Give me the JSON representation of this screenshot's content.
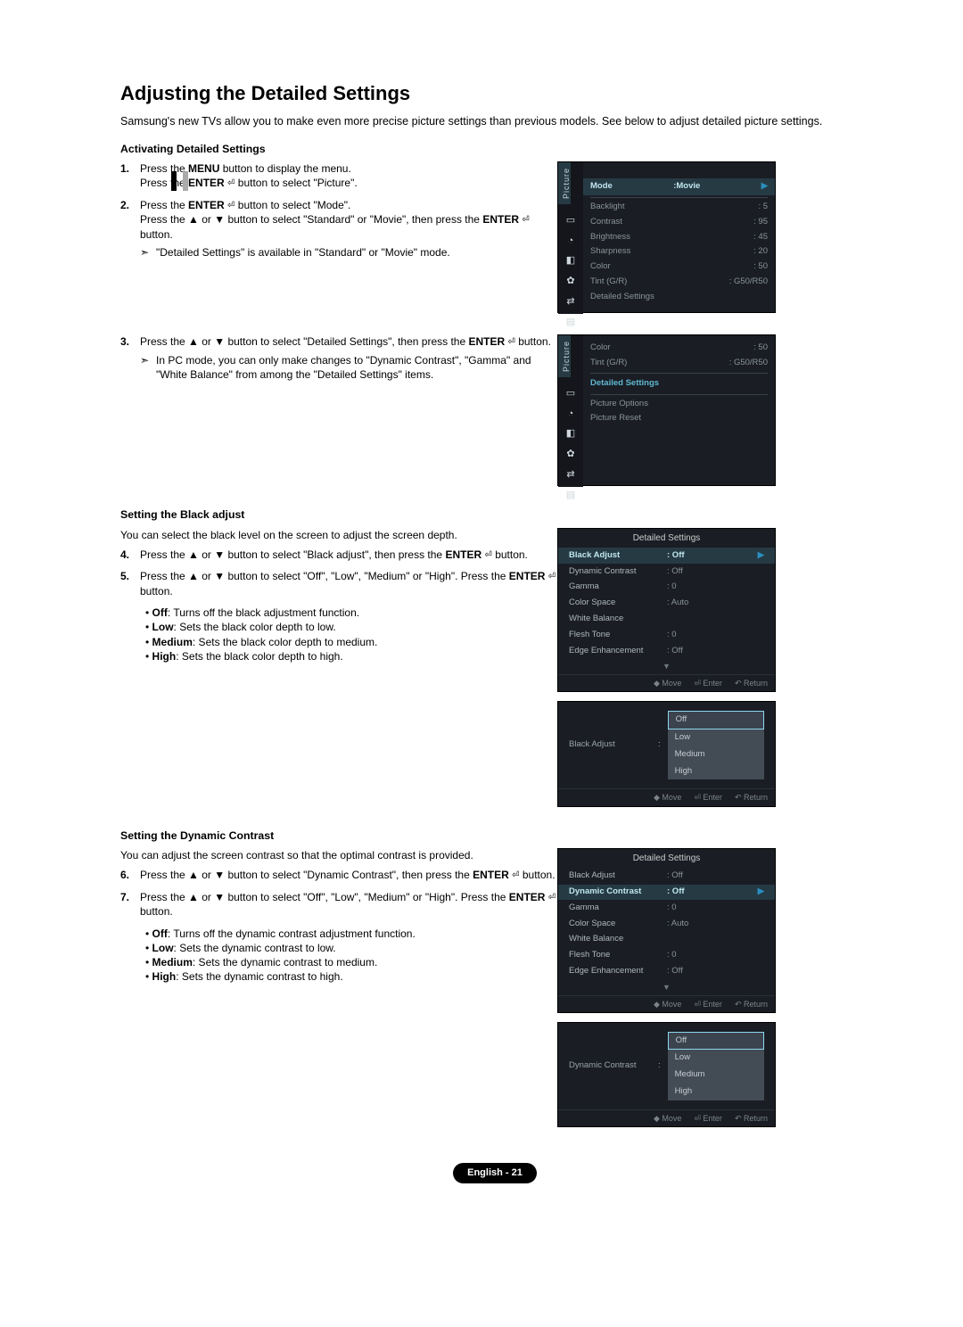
{
  "title": "Adjusting the Detailed Settings",
  "intro": "Samsung's new TVs allow you to make even more precise picture settings than previous models. See below to adjust detailed picture settings.",
  "sec1": {
    "heading": "Activating Detailed Settings",
    "items": [
      {
        "n": "1.",
        "lines": [
          "Press the <b>MENU</b> button to display the menu.",
          "Press the <b>ENTER</b> <span class='enter-icon'>⏎</span> button to select \"Picture\"."
        ]
      },
      {
        "n": "2.",
        "lines": [
          "Press the <b>ENTER</b> <span class='enter-icon'>⏎</span> button to select \"Mode\".",
          "Press the ▲ or ▼ button to select \"Standard\" or \"Movie\", then press the <b>ENTER</b> <span class='enter-icon'>⏎</span> button."
        ],
        "note": "\"Detailed Settings\" is available in \"Standard\" or \"Movie\" mode."
      },
      {
        "n": "3.",
        "lines": [
          "Press the ▲ or ▼ button to select \"Detailed Settings\", then press the <b>ENTER</b> <span class='enter-icon'>⏎</span> button."
        ],
        "note": "In PC mode, you can only make changes to \"Dynamic Contrast\", \"Gamma\" and \"White Balance\" from among the \"Detailed Settings\" items."
      }
    ]
  },
  "sec2": {
    "heading": "Setting the Black adjust",
    "desc": "You can select the black level on the screen to adjust the screen depth.",
    "items": [
      {
        "n": "4.",
        "lines": [
          "Press the ▲ or ▼ button to select \"Black adjust\", then press the <b>ENTER</b> <span class='enter-icon'>⏎</span> button."
        ]
      },
      {
        "n": "5.",
        "lines": [
          "Press the ▲ or ▼ button to select \"Off\", \"Low\", \"Medium\" or \"High\". Press the <b>ENTER</b> <span class='enter-icon'>⏎</span> button."
        ]
      }
    ],
    "bullets": [
      "<b>Off</b>: Turns off the black adjustment function.",
      "<b>Low</b>: Sets the black color depth to low.",
      "<b>Medium</b>: Sets the black color depth to medium.",
      "<b>High</b>: Sets the black color depth to high."
    ]
  },
  "sec3": {
    "heading": "Setting the Dynamic Contrast",
    "desc": "You can adjust the screen contrast so that the optimal contrast is provided.",
    "items": [
      {
        "n": "6.",
        "lines": [
          "Press the ▲ or ▼ button to select \"Dynamic Contrast\", then press the <b>ENTER</b> <span class='enter-icon'>⏎</span> button."
        ]
      },
      {
        "n": "7.",
        "lines": [
          "Press the ▲ or ▼ button to select \"Off\", \"Low\", \"Medium\" or \"High\". Press the <b>ENTER</b> <span class='enter-icon'>⏎</span> button."
        ]
      }
    ],
    "bullets": [
      "<b>Off</b>: Turns off the dynamic contrast adjustment function.",
      "<b>Low</b>: Sets the dynamic contrast to low.",
      "<b>Medium</b>: Sets the dynamic contrast to medium.",
      "<b>High</b>: Sets the dynamic contrast to high."
    ]
  },
  "osd1_tab": "Picture",
  "osd1_rows": [
    {
      "l": "Mode",
      "v": ":Movie",
      "hl": true,
      "arr": true
    },
    {
      "l": "Backlight",
      "v": ": 5"
    },
    {
      "l": "Contrast",
      "v": ": 95"
    },
    {
      "l": "Brightness",
      "v": ": 45"
    },
    {
      "l": "Sharpness",
      "v": ": 20"
    },
    {
      "l": "Color",
      "v": ": 50"
    },
    {
      "l": "Tint (G/R)",
      "v": ": G50/R50"
    },
    {
      "l": "Detailed Settings",
      "v": ""
    }
  ],
  "osd2_rows": [
    {
      "l": "Color",
      "v": ": 50"
    },
    {
      "l": "Tint (G/R)",
      "v": ": G50/R50"
    },
    {
      "l": "Detailed Settings",
      "v": "",
      "hl2": true
    },
    {
      "l": "Picture Options",
      "v": ""
    },
    {
      "l": "Picture Reset",
      "v": ""
    }
  ],
  "osd3_title": "Detailed Settings",
  "osd3_rows": [
    {
      "l": "Black Adjust",
      "v": ": Off",
      "sel": true,
      "arr": true
    },
    {
      "l": "Dynamic Contrast",
      "v": ": Off"
    },
    {
      "l": "Gamma",
      "v": ": 0"
    },
    {
      "l": "Color Space",
      "v": ": Auto"
    },
    {
      "l": "White Balance",
      "v": ""
    },
    {
      "l": "Flesh Tone",
      "v": ": 0"
    },
    {
      "l": "Edge Enhancement",
      "v": ": Off"
    }
  ],
  "popup1_label": "Black Adjust",
  "popup_opts": [
    "Off",
    "Low",
    "Medium",
    "High"
  ],
  "osd4_title": "Detailed Settings",
  "osd4_rows": [
    {
      "l": "Black Adjust",
      "v": ": Off"
    },
    {
      "l": "Dynamic Contrast",
      "v": ": Off",
      "sel": true,
      "arr": true
    },
    {
      "l": "Gamma",
      "v": ": 0"
    },
    {
      "l": "Color Space",
      "v": ": Auto"
    },
    {
      "l": "White Balance",
      "v": ""
    },
    {
      "l": "Flesh Tone",
      "v": ": 0"
    },
    {
      "l": "Edge Enhancement",
      "v": ": Off"
    }
  ],
  "popup2_label": "Dynamic Contrast",
  "footer_hints": {
    "move": "Move",
    "enter": "Enter",
    "return": "Return"
  },
  "page_footer": "English - 21"
}
